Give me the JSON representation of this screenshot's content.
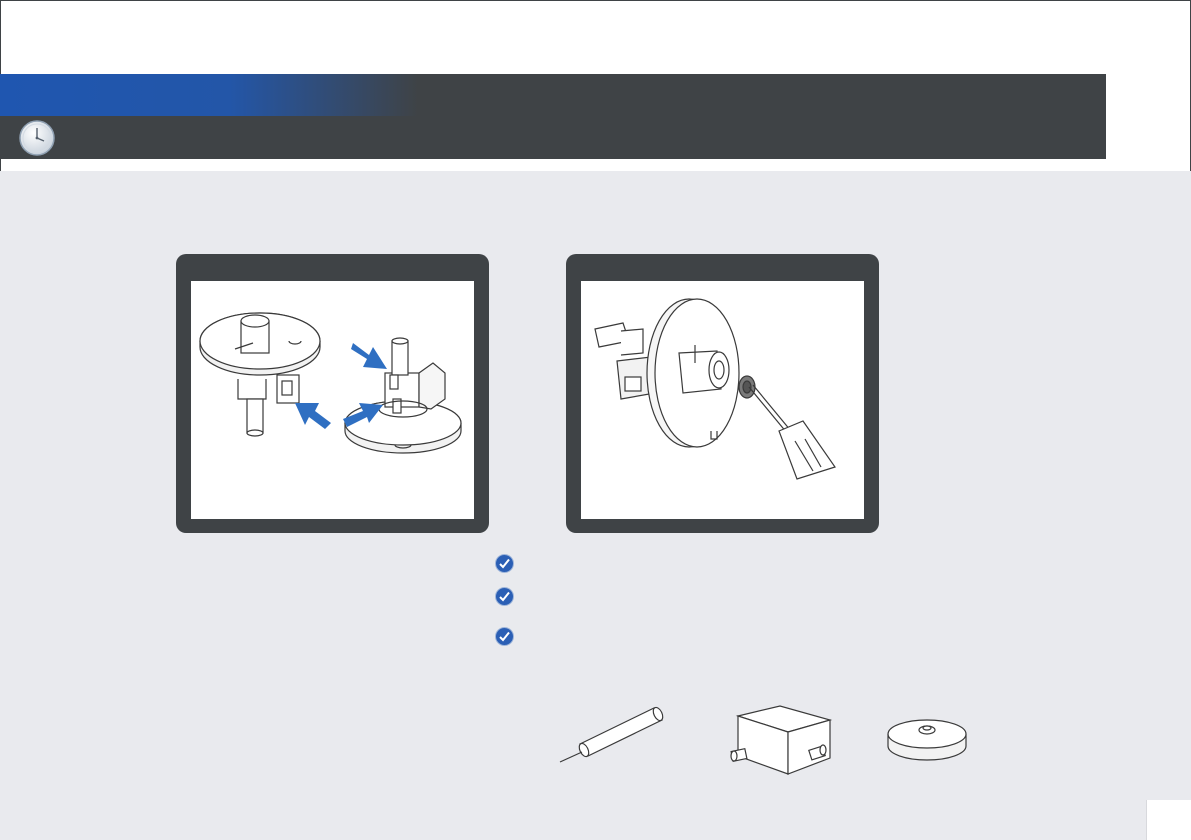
{
  "page": {
    "header_title": "",
    "header_subtitle": "",
    "page_number": ""
  },
  "icons": {
    "header": "clock-icon",
    "bullet": "checkmark-icon"
  },
  "colors": {
    "dark": "#3f4346",
    "accent_blue": "#1f56b0",
    "arrow_blue": "#2f6fc2",
    "background": "#e9eaee"
  },
  "figures": [
    {
      "id": "figure-1",
      "description": ""
    },
    {
      "id": "figure-2",
      "description": ""
    }
  ],
  "checklist": [
    "",
    "",
    ""
  ],
  "parts": [
    "pin-tool",
    "nozzle-block",
    "filter-disc"
  ]
}
